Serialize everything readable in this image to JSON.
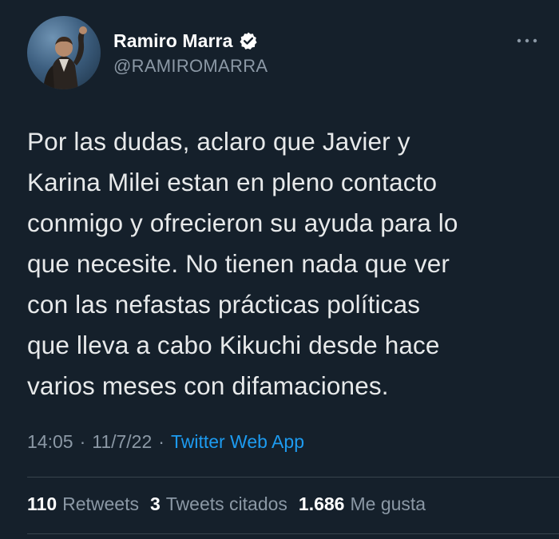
{
  "tweet": {
    "author": {
      "display_name": "Ramiro Marra",
      "handle": "@RAMIROMARRA",
      "verified": true,
      "avatar_icon": "profile-photo"
    },
    "more_icon": "more-options-icon",
    "text_lines": [
      "Por las dudas, aclaro que Javier y",
      "Karina Milei estan en pleno contacto",
      "conmigo y ofrecieron su ayuda para lo",
      "que necesite. No tienen nada que ver",
      "con las nefastas prácticas políticas",
      "que lleva a cabo Kikuchi desde hace",
      "varios meses con difamaciones."
    ],
    "time": "14:05",
    "separator": "·",
    "date": "11/7/22",
    "source": "Twitter Web App",
    "stats": {
      "retweets_count": "110",
      "retweets_label": "Retweets",
      "quotes_count": "3",
      "quotes_label": "Tweets citados",
      "likes_count": "1.686",
      "likes_label": "Me gusta"
    }
  },
  "colors": {
    "background": "#15202b",
    "text": "#e7e9ea",
    "secondary_text": "#8b98a5",
    "link": "#1d9bf0",
    "divider": "#38444d"
  }
}
